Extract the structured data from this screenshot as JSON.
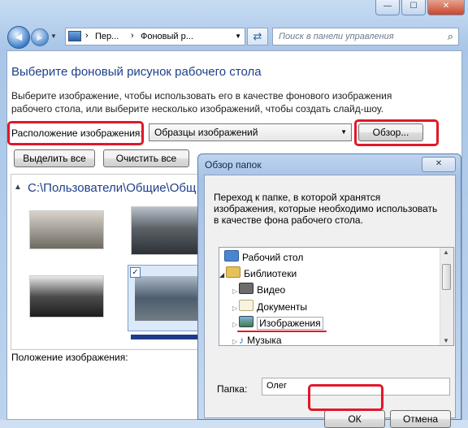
{
  "titlebar": {
    "minimize": "—",
    "maximize": "☐",
    "close": "✕"
  },
  "nav": {
    "back_glyph": "◀",
    "forward_glyph": "▶",
    "breadcrumb_1": "Пер...",
    "breadcrumb_2": "Фоновый р...",
    "search_placeholder": "Поиск в панели управления"
  },
  "main": {
    "heading": "Выберите фоновый рисунок рабочего стола",
    "description": "Выберите изображение, чтобы использовать его в качестве фонового изображения рабочего стола, или выберите несколько изображений, чтобы создать слайд-шоу.",
    "location_label": "Расположение изображения:",
    "location_value": "Образцы изображений",
    "browse_button": "Обзор...",
    "select_all_button": "Выделить все",
    "clear_all_button": "Очистить все",
    "folder_path": "C:\\Пользователи\\Общие\\Общ",
    "position_label": "Положение изображения:"
  },
  "dialog": {
    "title": "Обзор папок",
    "close": "✕",
    "description": "Переход к папке, в которой хранятся изображения, которые необходимо использовать в качестве фона рабочего стола.",
    "tree": [
      {
        "label": "Рабочий стол",
        "icon": "desktop-icon"
      },
      {
        "label": "Библиотеки",
        "icon": "libraries-icon"
      },
      {
        "label": "Видео",
        "icon": "video-icon"
      },
      {
        "label": "Документы",
        "icon": "documents-icon"
      },
      {
        "label": "Изображения",
        "icon": "pictures-icon"
      },
      {
        "label": "Музыка",
        "icon": "music-icon"
      }
    ],
    "folder_label": "Папка:",
    "folder_value": "Олег",
    "ok_button": "ОК",
    "cancel_button": "Отмена"
  },
  "colors": {
    "highlight": "#e0182a",
    "link_blue": "#1e3f8a",
    "heading_blue": "#1e3f8a"
  }
}
